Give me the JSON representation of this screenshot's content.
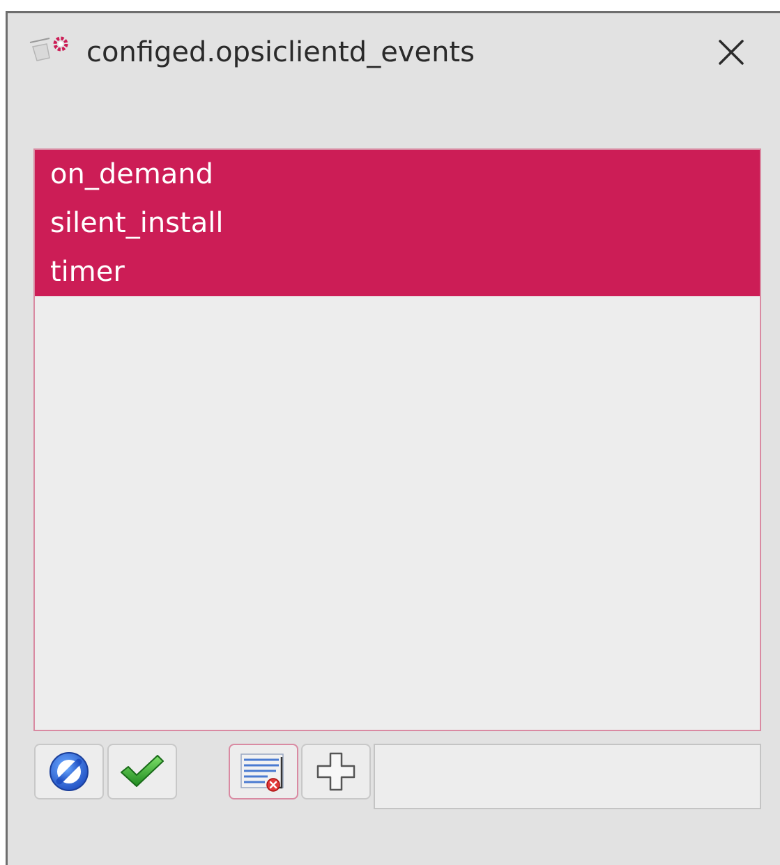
{
  "window": {
    "title": "configed.opsiclientd_events"
  },
  "list": {
    "items": [
      {
        "label": "on_demand",
        "selected": true
      },
      {
        "label": "silent_install",
        "selected": true
      },
      {
        "label": "timer",
        "selected": true
      }
    ]
  },
  "toolbar": {
    "cancel_icon": "cancel-icon",
    "ok_icon": "checkmark-icon",
    "remove_icon": "remove-entries-icon",
    "add_icon": "plus-icon",
    "input_value": ""
  },
  "colors": {
    "selection": "#cc1d56",
    "list_background": "#ededed",
    "window_background": "#e2e2e2"
  }
}
